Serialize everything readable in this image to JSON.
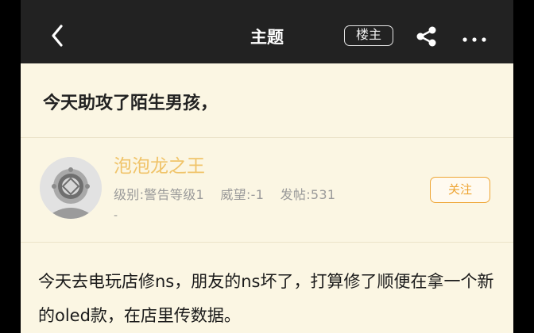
{
  "header": {
    "title": "主题",
    "louzhu_label": "楼主"
  },
  "post": {
    "title": "今天助攻了陌生男孩，",
    "author": {
      "name": "泡泡龙之王",
      "level": "级别:警告等级1",
      "reputation": "威望:-1",
      "posts": "发帖:531",
      "extra": "-"
    },
    "follow_label": "关注",
    "body": "今天去电玩店修ns，朋友的ns坏了，打算修了顺便在拿一个新的oled款，在店里传数据。"
  },
  "colors": {
    "topbar": "#222222",
    "background": "#fbf6e3",
    "accent": "#eea533",
    "username": "#f0c46a"
  }
}
